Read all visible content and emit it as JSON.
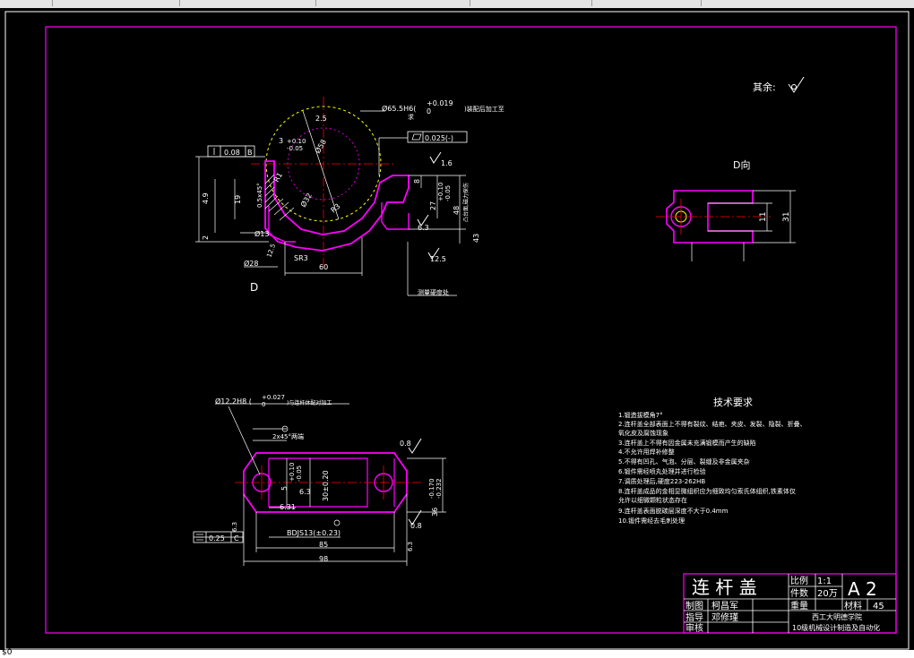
{
  "status_text": "$0",
  "remaining_roughness": "其余:",
  "view_label_d": "D",
  "view_label_d_direction": "D向",
  "tech_requirements": {
    "title": "技术要求",
    "items": [
      "1.锻造拔模角7°",
      "2.连杆盖全部表面上不得有裂纹、结疤、夹皮、发裂、隐裂、折叠、",
      "氧化皮及腐蚀现象",
      "3.连杆盖上不得有因金属未充满锻模而产生的缺陷",
      "4.不允许用焊补修整",
      "5.不得有凹孔、气泡、分层、裂缝及非金属夹杂",
      "6.锻件需经喷丸处理并进行检验",
      "7.调质处理后,硬度223-262HB",
      "8.连杆盖成品的金相显微组织应为细致均匀索氏体组织,铁素体仅",
      "允许以细微颗粒状态存在",
      "9.连杆盖表面脱碳层深度不大于0.4mm",
      "10.锻件需经去毛刺处理"
    ]
  },
  "title_block": {
    "part_name": "连 杆 盖",
    "scale_label": "比例",
    "scale_value": "1:1",
    "quantity_label": "件数",
    "quantity_value": "20万",
    "sheet_size": "A 2",
    "weight_label": "重量",
    "material_label": "材料",
    "material_value": "45",
    "drawn_label": "制图",
    "drawn_name": "柯昌军",
    "supervisor_label": "指导",
    "supervisor_name": "邓修瑾",
    "review_label": "审核",
    "school": "西工大明德学院",
    "class_name": "10级机械设计制造及自动化"
  },
  "view1_dims": {
    "bore": "Ø65.5H6(",
    "bore_tol_upper": "+0.019",
    "bore_tol_lower": "0",
    "bore_note": ")装配后加工至",
    "bore_note2": "求",
    "tol_perp": "0.08",
    "datum_b": "B",
    "tol_flat": "0.025(-)",
    "roughness_25": "2.5",
    "dim_3": "3",
    "dim_3_up": "+0.10",
    "dim_3_lo": "-0.05",
    "dim_r58": "Ø58",
    "dim_r32": "Ø32",
    "dim_r1": "R1",
    "dim_r3": "R3",
    "chamfer": "0.5x45°",
    "dim_19": "19",
    "dim_49": "4.9",
    "dim_2": "2",
    "dim_13": "Ø13",
    "dim_28": "Ø28",
    "dim_sr3": "SR3",
    "dim_60": "60",
    "dim_8": "8",
    "dim_27": "27",
    "dim_27_up": "+0.10",
    "dim_27_lo": "-0.05",
    "dim_48": "48",
    "dim_43": "43",
    "side_note": "凸台面,磁力探伤",
    "rough_16": "1.6",
    "rough_63": "6.3",
    "rough_125": "12.5",
    "rough_125b": "12.5",
    "hardness_note": "测量硬度处"
  },
  "view2_dims": {
    "hole": "Ø12.2H8 (",
    "hole_tol_up": "+0.027",
    "hole_tol_lo": "0",
    "hole_note": ")与连杆体配对加工",
    "chamfer": "2x45°两端",
    "dim_5": "5",
    "dim_5_up": "+0.10",
    "dim_5_lo": "-0.05",
    "dim_30": "30±0.20",
    "dim_63": "6.3",
    "dim_63b": "6.31",
    "dim_36": "36",
    "dim_36_up": "-0.170",
    "dim_36_lo": "-0.232",
    "dim_bdjs": "BDJS13(±0.23)",
    "dim_85": "85",
    "dim_98": "98",
    "rough_08": "0.8",
    "rough_08b": "0.8",
    "rough_63a": "6.3",
    "rough_63b": "6.3",
    "tol_sym": "0.25",
    "datum_c": "C"
  },
  "view3_dims": {
    "dim_11": "11",
    "dim_31": "31"
  },
  "colors": {
    "outline": "#ff00ff",
    "line": "#ffffff",
    "center": "#ff0000",
    "highlight": "#ffff00",
    "background": "#000000"
  }
}
